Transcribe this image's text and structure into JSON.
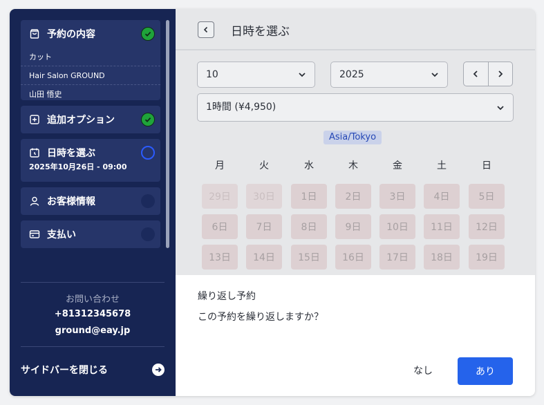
{
  "sidebar": {
    "steps": [
      {
        "label": "予約の内容",
        "status": "done",
        "details": [
          "カット",
          "Hair Salon GROUND",
          "山田 悟史"
        ]
      },
      {
        "label": "追加オプション",
        "status": "done"
      },
      {
        "label": "日時を選ぶ",
        "status": "current",
        "subline": "2025年10月26日 - 09:00"
      },
      {
        "label": "お客様情報",
        "status": "todo"
      },
      {
        "label": "支払い",
        "status": "todo"
      }
    ],
    "contact_heading": "お問い合わせ",
    "phone": "+81312345678",
    "email": "ground@eay.jp",
    "close_label": "サイドバーを閉じる"
  },
  "header": {
    "title": "日時を選ぶ"
  },
  "selectors": {
    "month": "10",
    "year": "2025",
    "duration": "1時間 (¥4,950)"
  },
  "timezone": "Asia/Tokyo",
  "calendar": {
    "weekdays": [
      "月",
      "火",
      "水",
      "木",
      "金",
      "土",
      "日"
    ],
    "weeks": [
      [
        "29日",
        "30日",
        "1日",
        "2日",
        "3日",
        "4日",
        "5日"
      ],
      [
        "6日",
        "7日",
        "8日",
        "9日",
        "10日",
        "11日",
        "12日"
      ],
      [
        "13日",
        "14日",
        "15日",
        "16日",
        "17日",
        "18日",
        "19日"
      ]
    ]
  },
  "dialog": {
    "title": "繰り返し予約",
    "question": "この予約を繰り返しますか？",
    "no_label": "なし",
    "yes_label": "あり"
  },
  "colors": {
    "sidebar_bg": "#172553",
    "accent": "#2563eb",
    "done": "#1fa33a"
  }
}
